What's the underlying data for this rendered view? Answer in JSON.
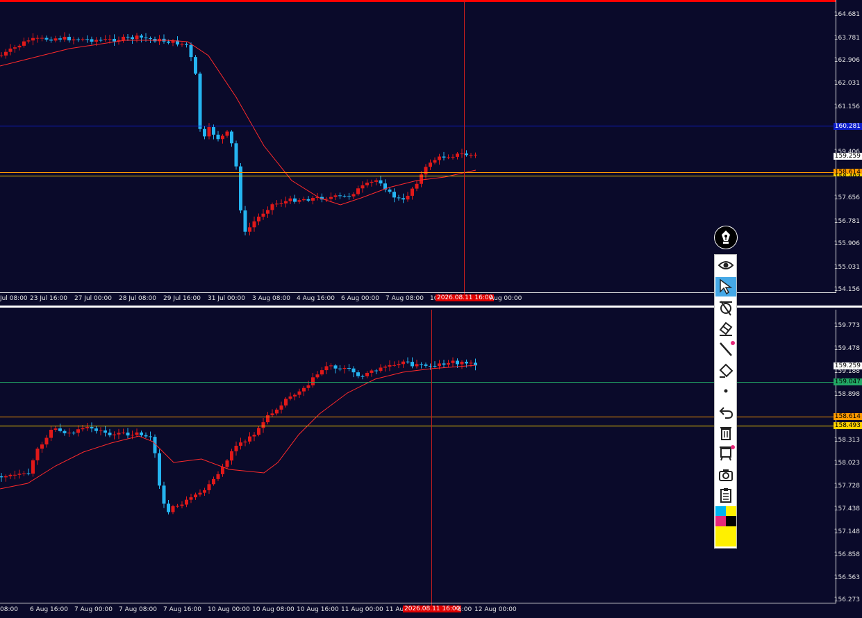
{
  "top_chart": {
    "price_ticks": [
      "164.681",
      "163.781",
      "162.906",
      "162.031",
      "161.156",
      "160.281",
      "159.406",
      "157.656",
      "156.781",
      "155.906",
      "155.031",
      "154.156"
    ],
    "current_price": "159.259",
    "hline_price": "158.614",
    "hline_price_2": "158.493",
    "time_labels": [
      "Jul 08:00",
      "23 Jul 16:00",
      "27 Jul 00:00",
      "28 Jul 08:00",
      "29 Jul 16:00",
      "31 Jul 00:00",
      "3 Aug 08:00",
      "4 Aug 16:00",
      "6 Aug 00:00",
      "7 Aug 08:00",
      "10",
      "Aug 00:00"
    ],
    "cursor_time": "2026.08.11 16:00"
  },
  "bottom_chart": {
    "price_ticks": [
      "159.773",
      "159.478",
      "159.188",
      "158.898",
      "158.313",
      "158.023",
      "157.728",
      "157.438",
      "157.148",
      "156.858",
      "156.563",
      "156.273"
    ],
    "current_price": "159.259",
    "green_line_price": "159.047",
    "orange_line_price": "158.614",
    "yellow_line_price": "158.493",
    "time_labels": [
      "08:00",
      "6 Aug 16:00",
      "7 Aug 00:00",
      "7 Aug 08:00",
      "7 Aug 16:00",
      "10 Aug 00:00",
      "10 Aug 08:00",
      "10 Aug 16:00",
      "11 Aug 00:00",
      "11 Au",
      "6:00",
      "12 Aug 00:00"
    ],
    "cursor_time": "2026.08.11 16:00"
  },
  "colors": {
    "background": "#0a0a2a",
    "bull_candle": "#e01919",
    "bear_candle": "#25b4f0",
    "moving_average": "#ff2a2a",
    "blue_line": "#0d1ec8",
    "orange_line": "#ff9900",
    "yellow_line": "#ffd200",
    "green_line": "#22aa66"
  },
  "toolbar": {
    "tools": [
      "pen-nib-icon",
      "eye-icon",
      "cursor-arrow-icon",
      "crosshair-icon",
      "eraser-icon",
      "line-draw-icon",
      "highlighter-icon",
      "dot-icon",
      "undo-icon",
      "trash-icon",
      "clear-all-icon",
      "camera-icon",
      "clipboard-icon",
      "color-palette"
    ]
  }
}
